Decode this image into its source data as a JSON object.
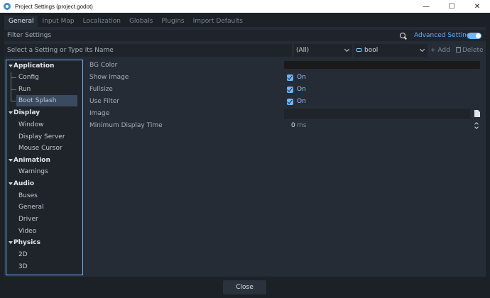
{
  "window": {
    "title": "Project Settings (project.godot)",
    "minimize_glyph": "—",
    "maximize_glyph": "☐",
    "close_glyph": "✕"
  },
  "tabs": [
    {
      "label": "General",
      "active": true
    },
    {
      "label": "Input Map"
    },
    {
      "label": "Localization"
    },
    {
      "label": "Globals"
    },
    {
      "label": "Plugins"
    },
    {
      "label": "Import Defaults"
    }
  ],
  "filter": {
    "label": "Filter Settings",
    "advanced_label": "Advanced Settings",
    "advanced_on": true
  },
  "search": {
    "placeholder": "Select a Setting or Type its Name",
    "type_filter": "(All)",
    "value_type": "bool",
    "add_label": "+ Add",
    "delete_label": "Delete"
  },
  "tree": {
    "sections": [
      {
        "label": "Application",
        "children": [
          "Config",
          "Run",
          "Boot Splash"
        ]
      },
      {
        "label": "Display",
        "children": [
          "Window",
          "Display Server",
          "Mouse Cursor"
        ]
      },
      {
        "label": "Animation",
        "children": [
          "Warnings"
        ]
      },
      {
        "label": "Audio",
        "children": [
          "Buses",
          "General",
          "Driver",
          "Video"
        ]
      },
      {
        "label": "Physics",
        "children": [
          "2D",
          "3D"
        ]
      }
    ],
    "selected": "Boot Splash"
  },
  "properties": [
    {
      "label": "BG Color",
      "type": "color",
      "color": "#1a1a1a"
    },
    {
      "label": "Show Image",
      "type": "bool",
      "value": "On"
    },
    {
      "label": "Fullsize",
      "type": "bool",
      "value": "On"
    },
    {
      "label": "Use Filter",
      "type": "bool",
      "value": "On"
    },
    {
      "label": "Image",
      "type": "file",
      "value": ""
    },
    {
      "label": "Minimum Display Time",
      "type": "number",
      "value": "0",
      "unit": "ms"
    }
  ],
  "footer": {
    "close_label": "Close"
  },
  "colors": {
    "accent": "#6fb6ff",
    "background": "#1c2128",
    "panel": "#262c35"
  }
}
